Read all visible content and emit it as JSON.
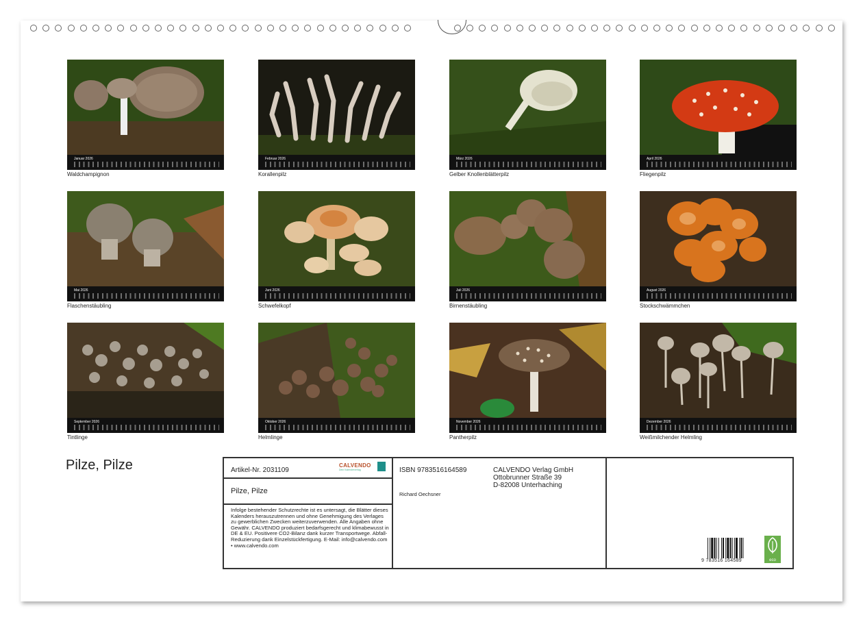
{
  "calendar": {
    "title": "Pilze, Pilze",
    "months": [
      {
        "month": "Januar 2026",
        "caption": "Waldchampignon"
      },
      {
        "month": "Februar 2026",
        "caption": "Korallenpilz"
      },
      {
        "month": "März 2026",
        "caption": "Gelber Knollenblätterpilz"
      },
      {
        "month": "April 2026",
        "caption": "Fliegenpilz"
      },
      {
        "month": "Mai 2026",
        "caption": "Flaschenstäubling"
      },
      {
        "month": "Juni 2026",
        "caption": "Schwefelkopf"
      },
      {
        "month": "Juli 2026",
        "caption": "Birnenstäubling"
      },
      {
        "month": "August 2026",
        "caption": "Stockschwämmchen"
      },
      {
        "month": "September 2026",
        "caption": "Tintlinge"
      },
      {
        "month": "Oktober 2026",
        "caption": "Helmlinge"
      },
      {
        "month": "November 2026",
        "caption": "Pantherpilz"
      },
      {
        "month": "Dezember 2026",
        "caption": "Weißmilchender Helmling"
      }
    ]
  },
  "info": {
    "article": "Artikel-Nr. 2031109",
    "logo": "CALVENDO",
    "logo_sub": "Dein Kalenderverlag",
    "book_title": "Pilze, Pilze",
    "legal": "Infolge bestehender Schutzrechte ist es untersagt, die Blätter dieses Kalenders herauszutrennen und ohne Genehmigung des Verlages zu gewerblichen Zwecken weiterzuverwenden. Alle Angaben ohne Gewähr. CALVENDO produziert bedarfsgerecht und klimabewusst in DE & EU. Positivere CO2-Bilanz dank kurzer Transportwege. Abfall-Reduzierung dank Einzelstückfertigung. E-Mail: info@calvendo.com • www.calvendo.com",
    "isbn": "ISBN 9783516164589",
    "author": "Richard Oechsner",
    "publisher_name": "CALVENDO Verlag GmbH",
    "publisher_street": "Ottobrunner Straße 39",
    "publisher_city": "D-82008 Unterhaching",
    "barcode_number": "9 783516 164589",
    "eco_label": "eco"
  },
  "colors": {
    "moss": "#3e5a1c",
    "dark_bg": "#1a1a14",
    "amanita_red": "#d33a14",
    "cap_brown": "#8a7560",
    "orange_cap": "#d8741e"
  }
}
